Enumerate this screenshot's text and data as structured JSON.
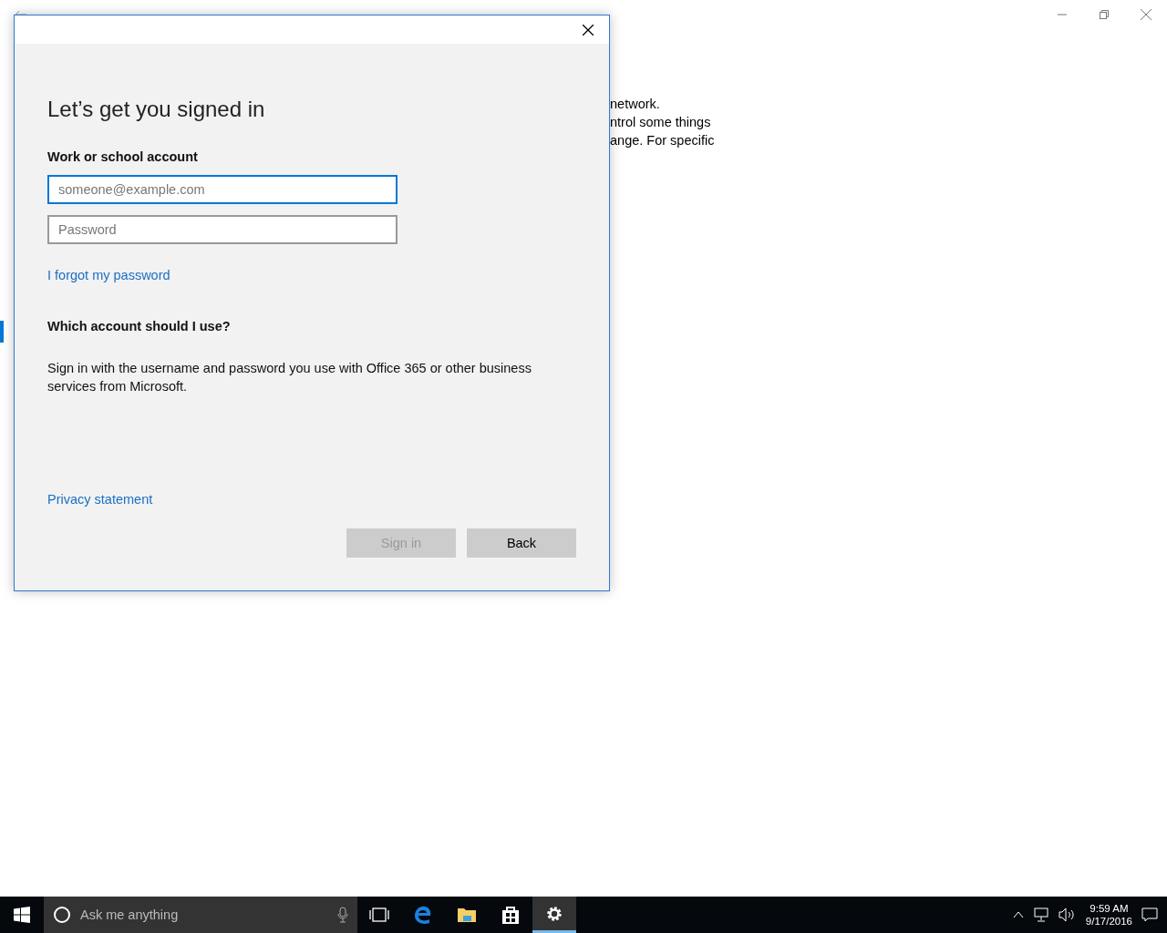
{
  "background_text": [
    "network.",
    "ntrol some things",
    "ange. For specific"
  ],
  "dialog": {
    "heading": "Let’s get you signed in",
    "account_label": "Work or school account",
    "fields": [
      {
        "placeholder": "someone@example.com",
        "focused": true
      },
      {
        "placeholder": "Password",
        "focused": false
      }
    ],
    "forgot_link": "I forgot my password",
    "help_heading": "Which account should I use?",
    "help_text": "Sign in with the username and password you use with Office 365 or other business services from Microsoft.",
    "privacy_link": "Privacy statement",
    "buttons": [
      {
        "label": "Sign in",
        "disabled": true
      },
      {
        "label": "Back",
        "disabled": false
      }
    ]
  },
  "taskbar": {
    "search_placeholder": "Ask me anything",
    "apps": [
      {
        "kind": "taskview",
        "selected": false
      },
      {
        "kind": "edge",
        "selected": false
      },
      {
        "kind": "explorer",
        "selected": false
      },
      {
        "kind": "store",
        "selected": false
      },
      {
        "kind": "settings",
        "selected": true
      }
    ],
    "time": "9:59 AM",
    "date": "9/17/2016"
  }
}
